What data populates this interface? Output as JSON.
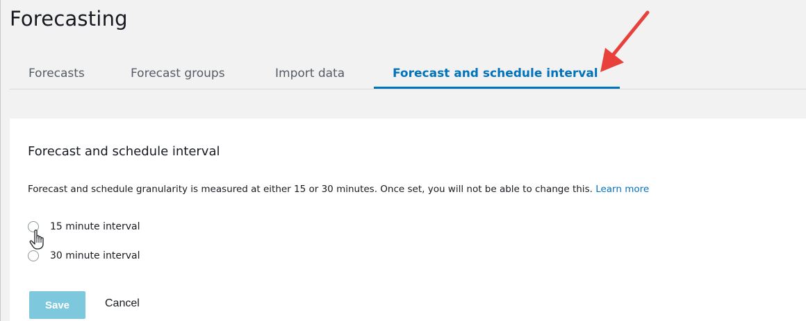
{
  "header": {
    "title": "Forecasting"
  },
  "tabs": [
    {
      "label": "Forecasts",
      "active": false
    },
    {
      "label": "Forecast groups",
      "active": false
    },
    {
      "label": "Import data",
      "active": false
    },
    {
      "label": "Forecast and schedule interval",
      "active": true
    }
  ],
  "section": {
    "title": "Forecast and schedule interval",
    "description": "Forecast and schedule granularity is measured at either 15 or 30 minutes. Once set, you will not be able to change this.",
    "learn_more": "Learn more"
  },
  "options": [
    {
      "label": "15 minute interval",
      "selected": false
    },
    {
      "label": "30 minute interval",
      "selected": false
    }
  ],
  "actions": {
    "save_label": "Save",
    "cancel_label": "Cancel"
  },
  "colors": {
    "accent": "#0073bb",
    "save_button": "#7ec8de",
    "annotation_arrow": "#e8403a",
    "page_background": "#f2f2f2"
  },
  "icons": {
    "cursor": "hand-pointer-icon",
    "annotation": "red-arrow-icon"
  }
}
